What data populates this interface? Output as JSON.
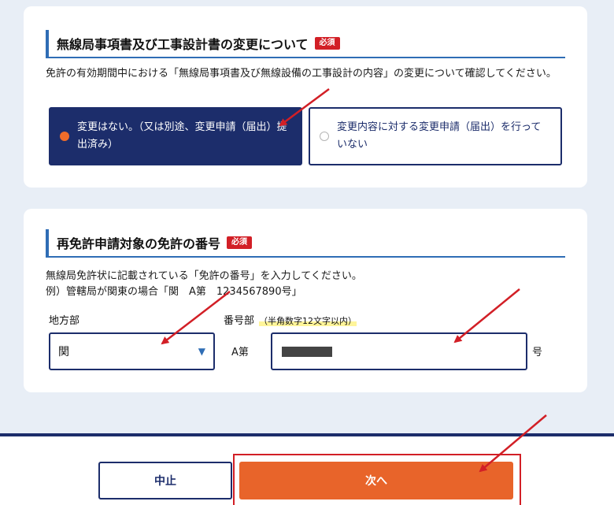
{
  "section1": {
    "title": "無線局事項書及び工事設計書の変更について",
    "required_badge": "必須",
    "description": "免許の有効期間中における「無線局事項書及び無線設備の工事設計の内容」の変更について確認してください。",
    "options": [
      {
        "label": "変更はない。（又は別途、変更申請（届出）提出済み）",
        "selected": true
      },
      {
        "label": "変更内容に対する変更申請（届出）を行っていない",
        "selected": false
      }
    ]
  },
  "section2": {
    "title": "再免許申請対象の免許の番号",
    "required_badge": "必須",
    "description_line1": "無線局免許状に記載されている「免許の番号」を入力してください。",
    "description_line2": "例）管轄局が関東の場合「関　A第　1234567890号」",
    "region_label": "地方部",
    "region_value": "関",
    "number_label": "番号部",
    "number_hint": "（半角数字12文字以内）",
    "number_prefix": "A第",
    "number_suffix": "号"
  },
  "footer": {
    "cancel_label": "中止",
    "next_label": "次へ"
  },
  "colors": {
    "navy": "#1c2d6b",
    "accent_blue": "#2f6db5",
    "orange": "#e8642a",
    "required_red": "#d21f26",
    "annotation_red": "#d21f26"
  }
}
